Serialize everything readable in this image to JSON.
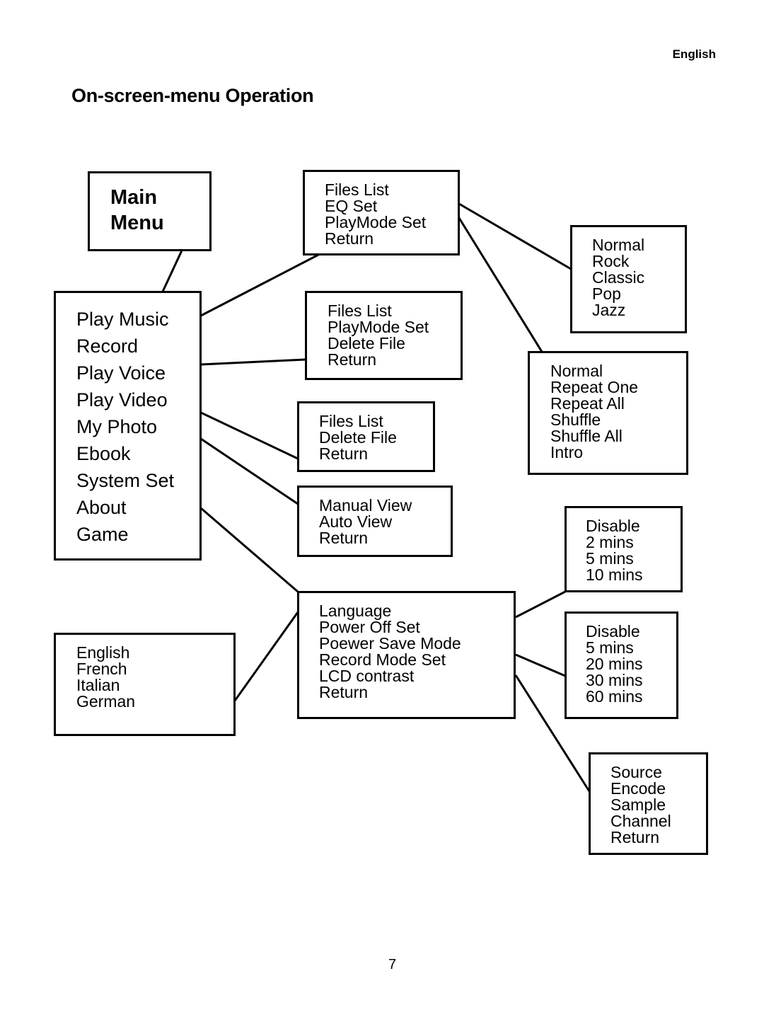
{
  "header": {
    "language": "English"
  },
  "page": {
    "title": "On-screen-menu Operation",
    "number": "7"
  },
  "diagram": {
    "main_menu": {
      "items": [
        "Main",
        "Menu"
      ]
    },
    "main_items": {
      "items": [
        "Play Music",
        "Record",
        "Play Voice",
        "Play Video",
        "My Photo",
        "Ebook",
        "System Set",
        "About",
        "Game"
      ]
    },
    "play_music_menu": {
      "items": [
        "Files List",
        "EQ Set",
        "PlayMode Set",
        "Return"
      ]
    },
    "eq_menu": {
      "items": [
        "Normal",
        "Rock",
        "Classic",
        "Pop",
        "Jazz"
      ]
    },
    "playmode_menu": {
      "items": [
        "Normal",
        "Repeat One",
        "Repeat All",
        "Shuffle",
        "Shuffle All",
        "Intro"
      ]
    },
    "play_voice_menu": {
      "items": [
        "Files List",
        "PlayMode Set",
        "Delete File",
        "Return"
      ]
    },
    "play_video_menu": {
      "items": [
        "Files List",
        "Delete File",
        "Return"
      ]
    },
    "photo_menu": {
      "items": [
        "Manual View",
        "Auto View",
        "Return"
      ]
    },
    "system_menu": {
      "items": [
        "Language",
        "Power Off Set",
        "Poewer Save Mode",
        "Record Mode Set",
        "LCD contrast",
        "Return"
      ]
    },
    "language_menu": {
      "items": [
        "English",
        "French",
        "Italian",
        "German"
      ]
    },
    "power_off_menu": {
      "items": [
        "Disable",
        "2 mins",
        "5 mins",
        "10 mins"
      ]
    },
    "power_save_menu": {
      "items": [
        "Disable",
        "5 mins",
        "20 mins",
        "30 mins",
        "60 mins"
      ]
    },
    "record_mode_menu": {
      "items": [
        "Source",
        "Encode",
        "Sample",
        "Channel",
        "Return"
      ]
    }
  }
}
